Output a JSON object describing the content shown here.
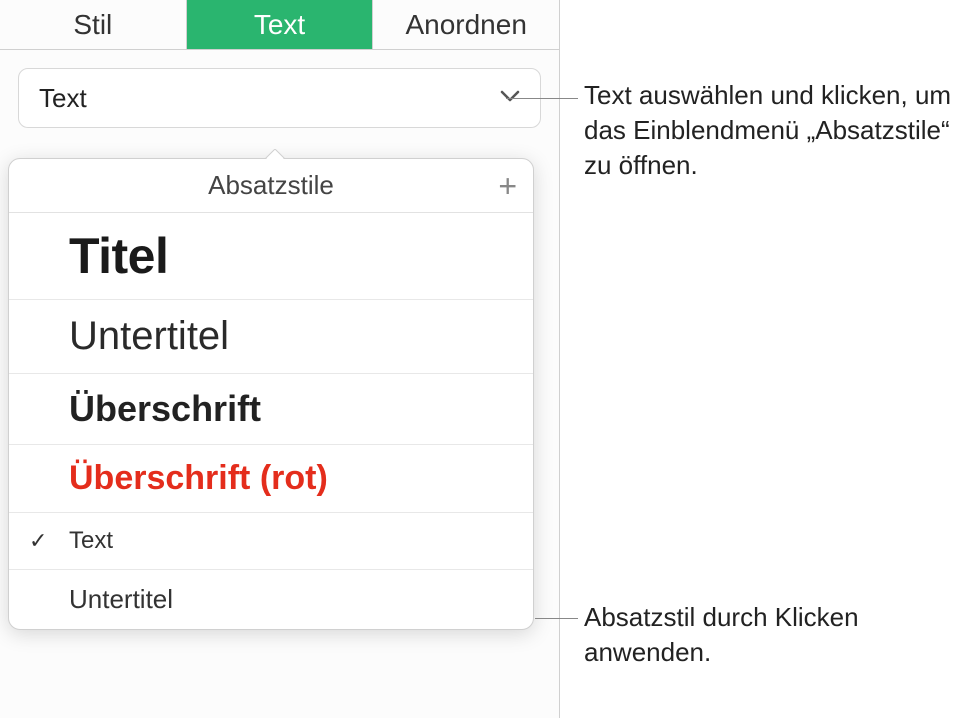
{
  "tabs": {
    "stil": "Stil",
    "text": "Text",
    "anordnen": "Anordnen"
  },
  "styleSelector": {
    "current": "Text"
  },
  "popover": {
    "title": "Absatzstile",
    "items": [
      {
        "label": "Titel",
        "selected": false
      },
      {
        "label": "Untertitel",
        "selected": false
      },
      {
        "label": "Überschrift",
        "selected": false
      },
      {
        "label": "Überschrift (rot)",
        "selected": false
      },
      {
        "label": "Text",
        "selected": true
      },
      {
        "label": "Untertitel",
        "selected": false
      }
    ]
  },
  "callouts": {
    "c1": "Text auswählen und klicken, um das Einblendmenü „Absatzstile“ zu öffnen.",
    "c2": "Absatzstil durch Klicken anwenden."
  }
}
